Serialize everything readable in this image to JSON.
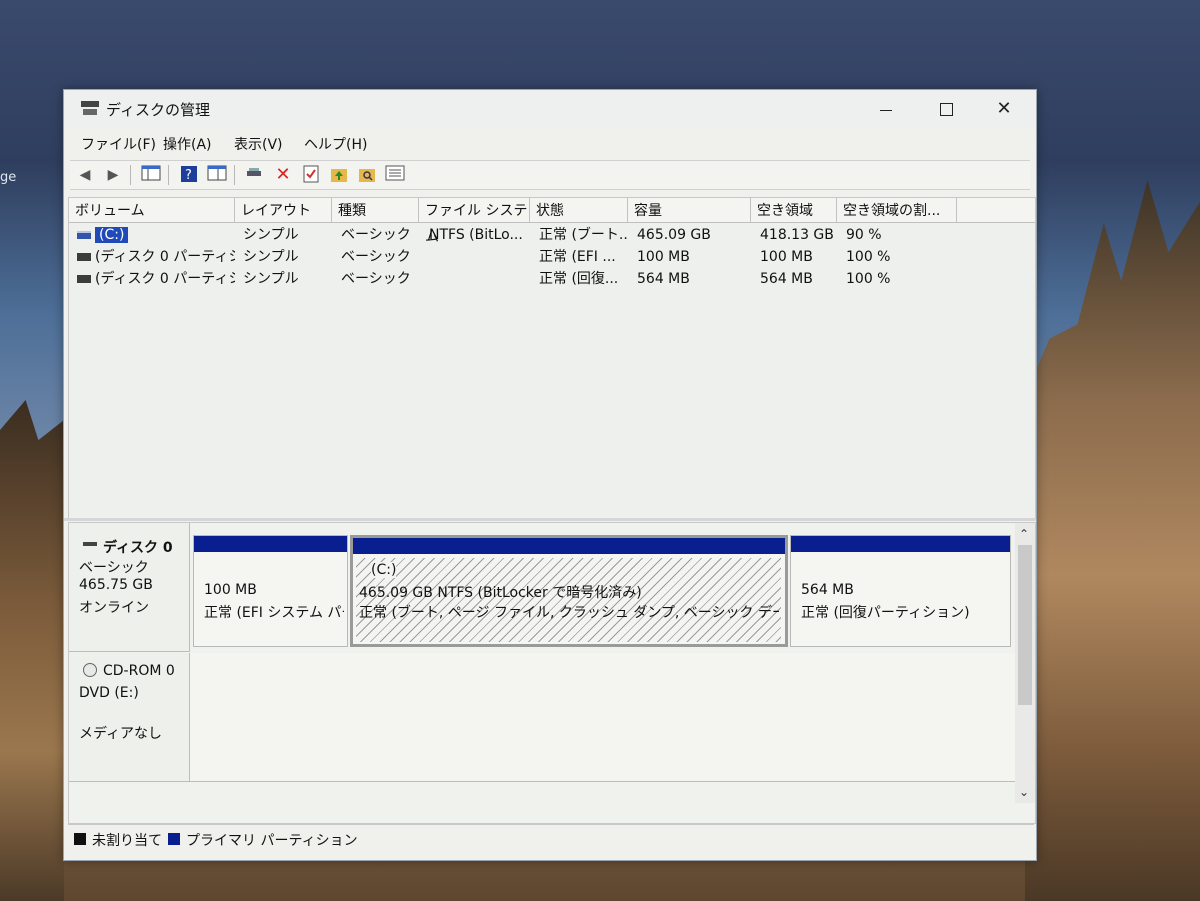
{
  "desktop": {
    "edge_label": "ge"
  },
  "window": {
    "title": "ディスクの管理",
    "controls": {
      "minimize": "",
      "maximize": "",
      "close": "✕"
    }
  },
  "menu": [
    "ファイル(F)",
    "操作(A)",
    "表示(V)",
    "ヘルプ(H)"
  ],
  "toolbar": {
    "icons": [
      "back-arrow-icon",
      "forward-arrow-icon",
      "console-tree-icon",
      "help-icon",
      "properties-icon",
      "connect-icon",
      "delete-icon",
      "check-icon",
      "up-folder-icon",
      "search-folder-icon",
      "list-icon"
    ]
  },
  "volumes": {
    "columns": [
      "ボリューム",
      "レイアウト",
      "種類",
      "ファイル システム",
      "状態",
      "容量",
      "空き領域",
      "空き領域の割..."
    ],
    "rows": [
      {
        "name": "(C:)",
        "layout": "シンプル",
        "type": "ベーシック",
        "fs": "NTFS (BitLo...",
        "status": "正常 (ブート...",
        "capacity": "465.09 GB",
        "free": "418.13 GB",
        "pct": "90 %"
      },
      {
        "name": "(ディスク 0 パーティシ...",
        "layout": "シンプル",
        "type": "ベーシック",
        "fs": "",
        "status": "正常 (EFI ...",
        "capacity": "100 MB",
        "free": "100 MB",
        "pct": "100 %"
      },
      {
        "name": "(ディスク 0 パーティシ...",
        "layout": "シンプル",
        "type": "ベーシック",
        "fs": "",
        "status": "正常 (回復...",
        "capacity": "564 MB",
        "free": "564 MB",
        "pct": "100 %"
      }
    ]
  },
  "disks": {
    "disk0": {
      "title": "ディスク 0",
      "type": "ベーシック",
      "size": "465.75 GB",
      "state": "オンライン",
      "partitions": [
        {
          "line1": "100 MB",
          "line2": "正常 (EFI システム パーティション)"
        },
        {
          "line0": "(C:)",
          "line1": "465.09 GB NTFS (BitLocker で暗号化済み)",
          "line2": "正常 (ブート, ページ ファイル, クラッシュ ダンプ, ベーシック データ パーティション)"
        },
        {
          "line1": "564 MB",
          "line2": "正常 (回復パーティション)"
        }
      ]
    },
    "cdrom0": {
      "title": "CD-ROM 0",
      "drive": "DVD (E:)",
      "media": "メディアなし"
    }
  },
  "legend": {
    "unallocated": "未割り当て",
    "primary": "プライマリ パーティション",
    "colors": {
      "unallocated": "#111111",
      "primary": "#0a1f8f"
    }
  }
}
